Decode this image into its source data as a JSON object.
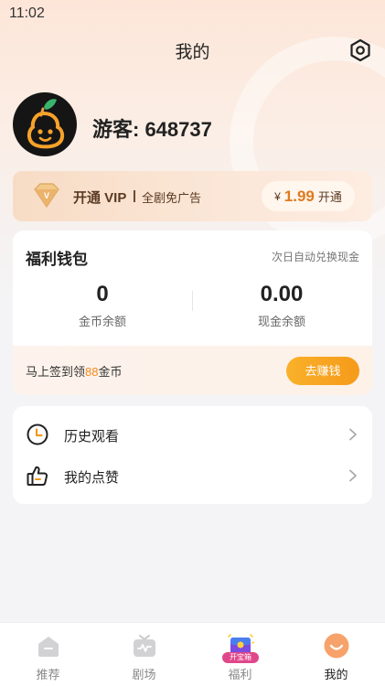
{
  "status_bar": {
    "time": "11:02"
  },
  "header": {
    "title": "我的"
  },
  "profile": {
    "username": "游客: 648737"
  },
  "vip": {
    "title": "开通 VIP",
    "subtitle": "全剧免广告",
    "currency": "¥",
    "price": "1.99",
    "action": "开通"
  },
  "wallet": {
    "title": "福利钱包",
    "note": "次日自动兑换现金",
    "coins": {
      "value": "0",
      "label": "金币余额"
    },
    "cash": {
      "value": "0.00",
      "label": "现金余额"
    },
    "signin": {
      "prefix": "马上签到领",
      "amount": "88",
      "suffix": "金币",
      "button": "去赚钱"
    }
  },
  "menu": {
    "items": [
      {
        "label": "历史观看",
        "icon": "clock-icon"
      },
      {
        "label": "我的点赞",
        "icon": "thumbs-up-icon"
      }
    ]
  },
  "tabbar": {
    "tabs": [
      {
        "label": "推荐",
        "icon": "home-icon"
      },
      {
        "label": "剧场",
        "icon": "tv-icon"
      },
      {
        "label": "福利",
        "icon": "treasure-box-icon",
        "badge": "开宝箱"
      },
      {
        "label": "我的",
        "icon": "smile-icon",
        "active": true
      }
    ]
  },
  "colors": {
    "accent": "#f69a1a",
    "vip_text": "#5a3a22",
    "price": "#e07a1e",
    "badge": "#e0478a"
  }
}
